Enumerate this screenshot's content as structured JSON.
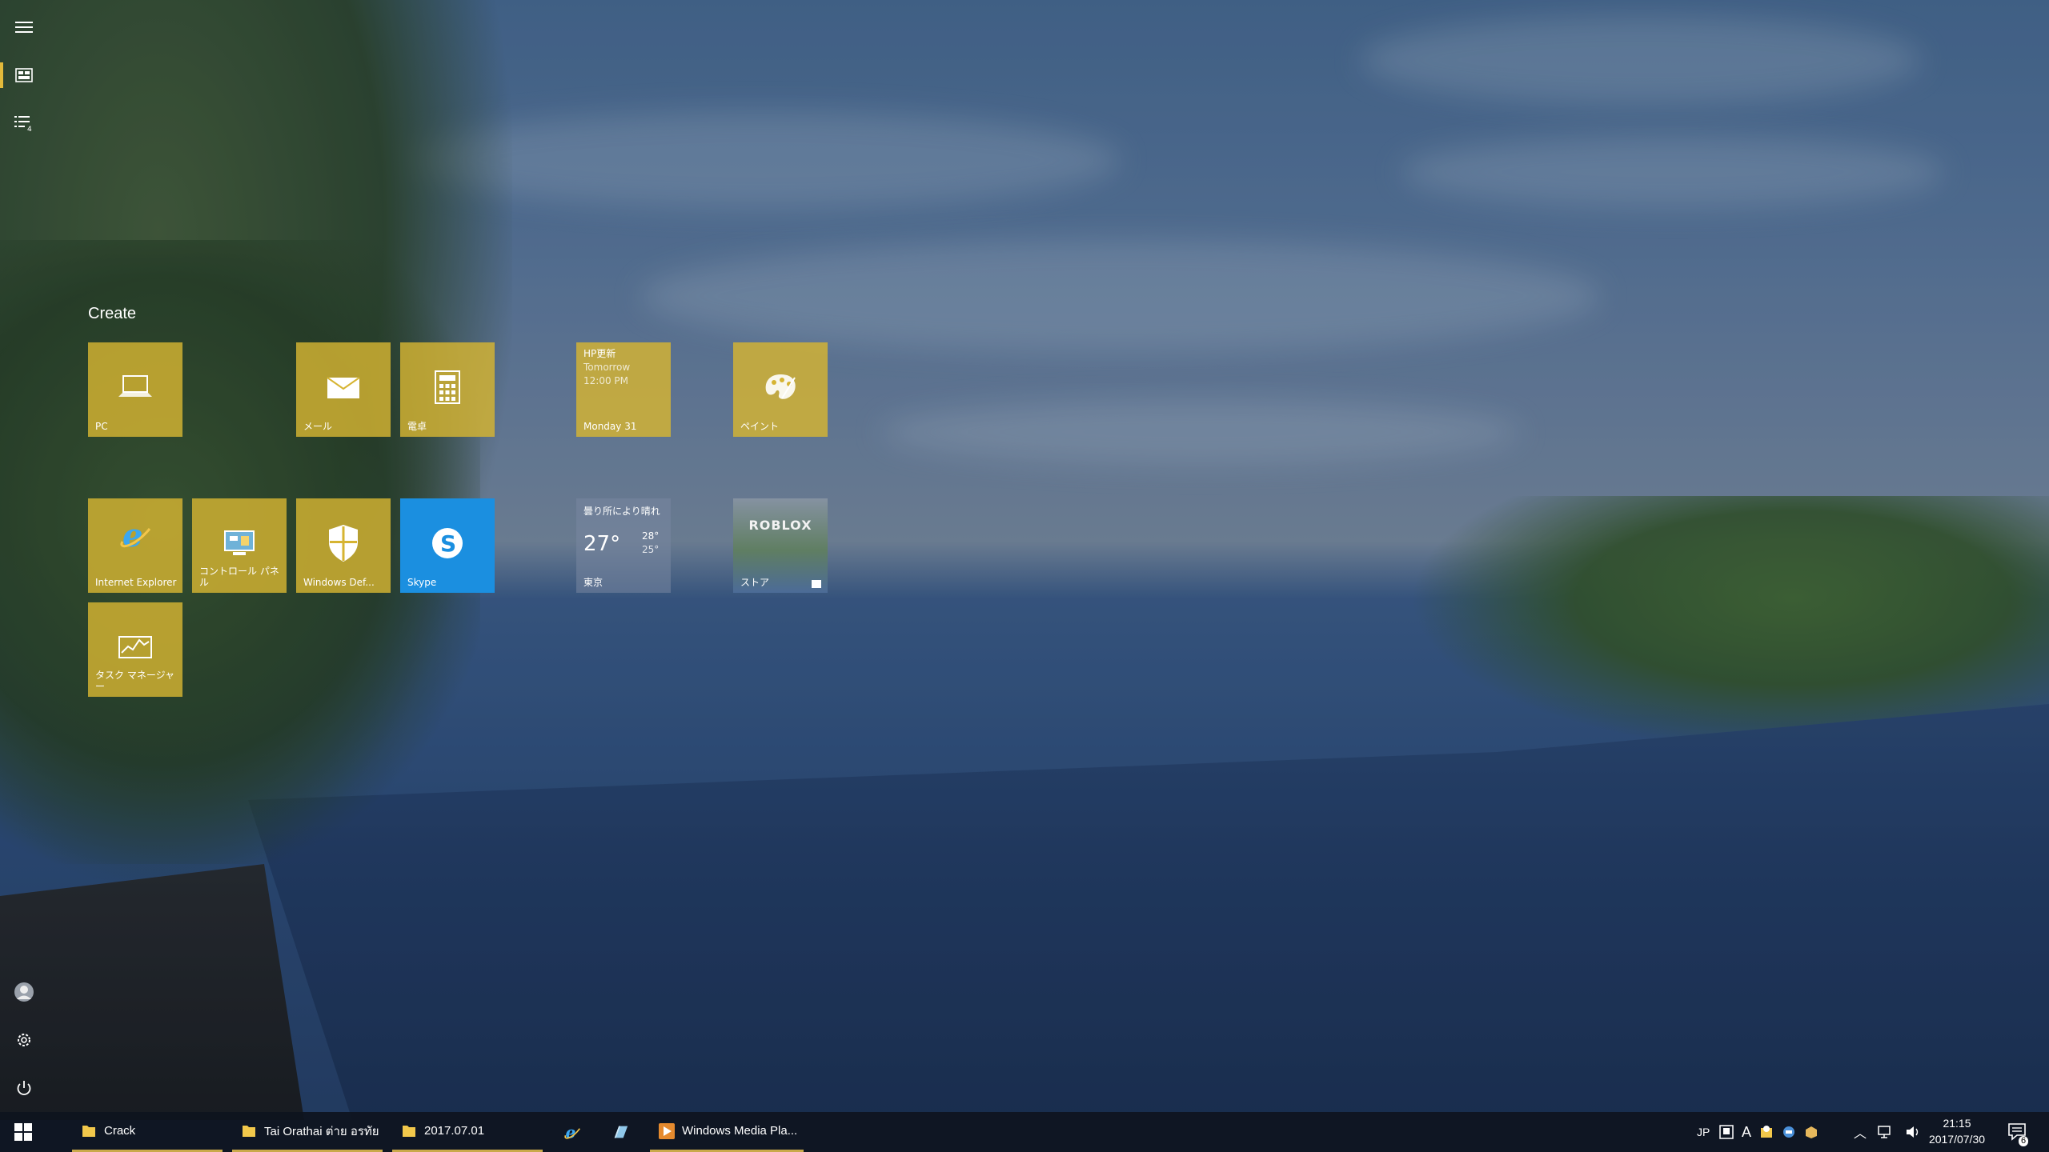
{
  "start": {
    "group_title": "Create",
    "rail": [
      {
        "name": "hamburger-menu-icon",
        "glyph": "☰"
      },
      {
        "name": "tiles-view-icon",
        "glyph": "▦"
      },
      {
        "name": "all-apps-list-icon",
        "glyph": "☷"
      },
      {
        "name": "user-avatar-icon",
        "glyph": "☺"
      },
      {
        "name": "settings-gear-icon",
        "glyph": "⚙"
      },
      {
        "name": "power-icon",
        "glyph": "⏻"
      }
    ],
    "tiles": {
      "pc": {
        "label": "PC"
      },
      "mail": {
        "label": "メール"
      },
      "calculator": {
        "label": "電卓"
      },
      "calendar": {
        "line1": "HP更新",
        "line2": "Tomorrow",
        "line3": "12:00 PM",
        "label": "Monday 31"
      },
      "paint": {
        "label": "ペイント"
      },
      "ie": {
        "label": "Internet Explorer"
      },
      "control_panel": {
        "label": "コントロール パネル"
      },
      "defender": {
        "label": "Windows Def..."
      },
      "skype": {
        "label": "Skype"
      },
      "weather": {
        "condition": "曇り所により晴れ",
        "temp": "27°",
        "high": "28°",
        "low": "25°",
        "label": "東京"
      },
      "store": {
        "game_title": "ROBLOX",
        "label": "ストア"
      },
      "task_manager": {
        "label": "タスク マネージャー"
      }
    }
  },
  "taskbar": {
    "items": [
      {
        "label": "Crack",
        "icon": "folder-icon"
      },
      {
        "label": "Tai Orathai ต่าย อรทัย",
        "icon": "folder-icon"
      },
      {
        "label": "2017.07.01",
        "icon": "folder-icon"
      },
      {
        "label": "",
        "icon": "internet-explorer-icon"
      },
      {
        "label": "",
        "icon": "app-icon"
      },
      {
        "label": "Windows Media Pla...",
        "icon": "windows-media-player-icon"
      }
    ],
    "ime": "JP",
    "ime_mode": "A",
    "time": "21:15",
    "date": "2017/07/30",
    "notification_count": "6"
  },
  "colors": {
    "tile": "#d6b432",
    "accent": "#e2b93b",
    "skype": "#1b8fe0"
  }
}
